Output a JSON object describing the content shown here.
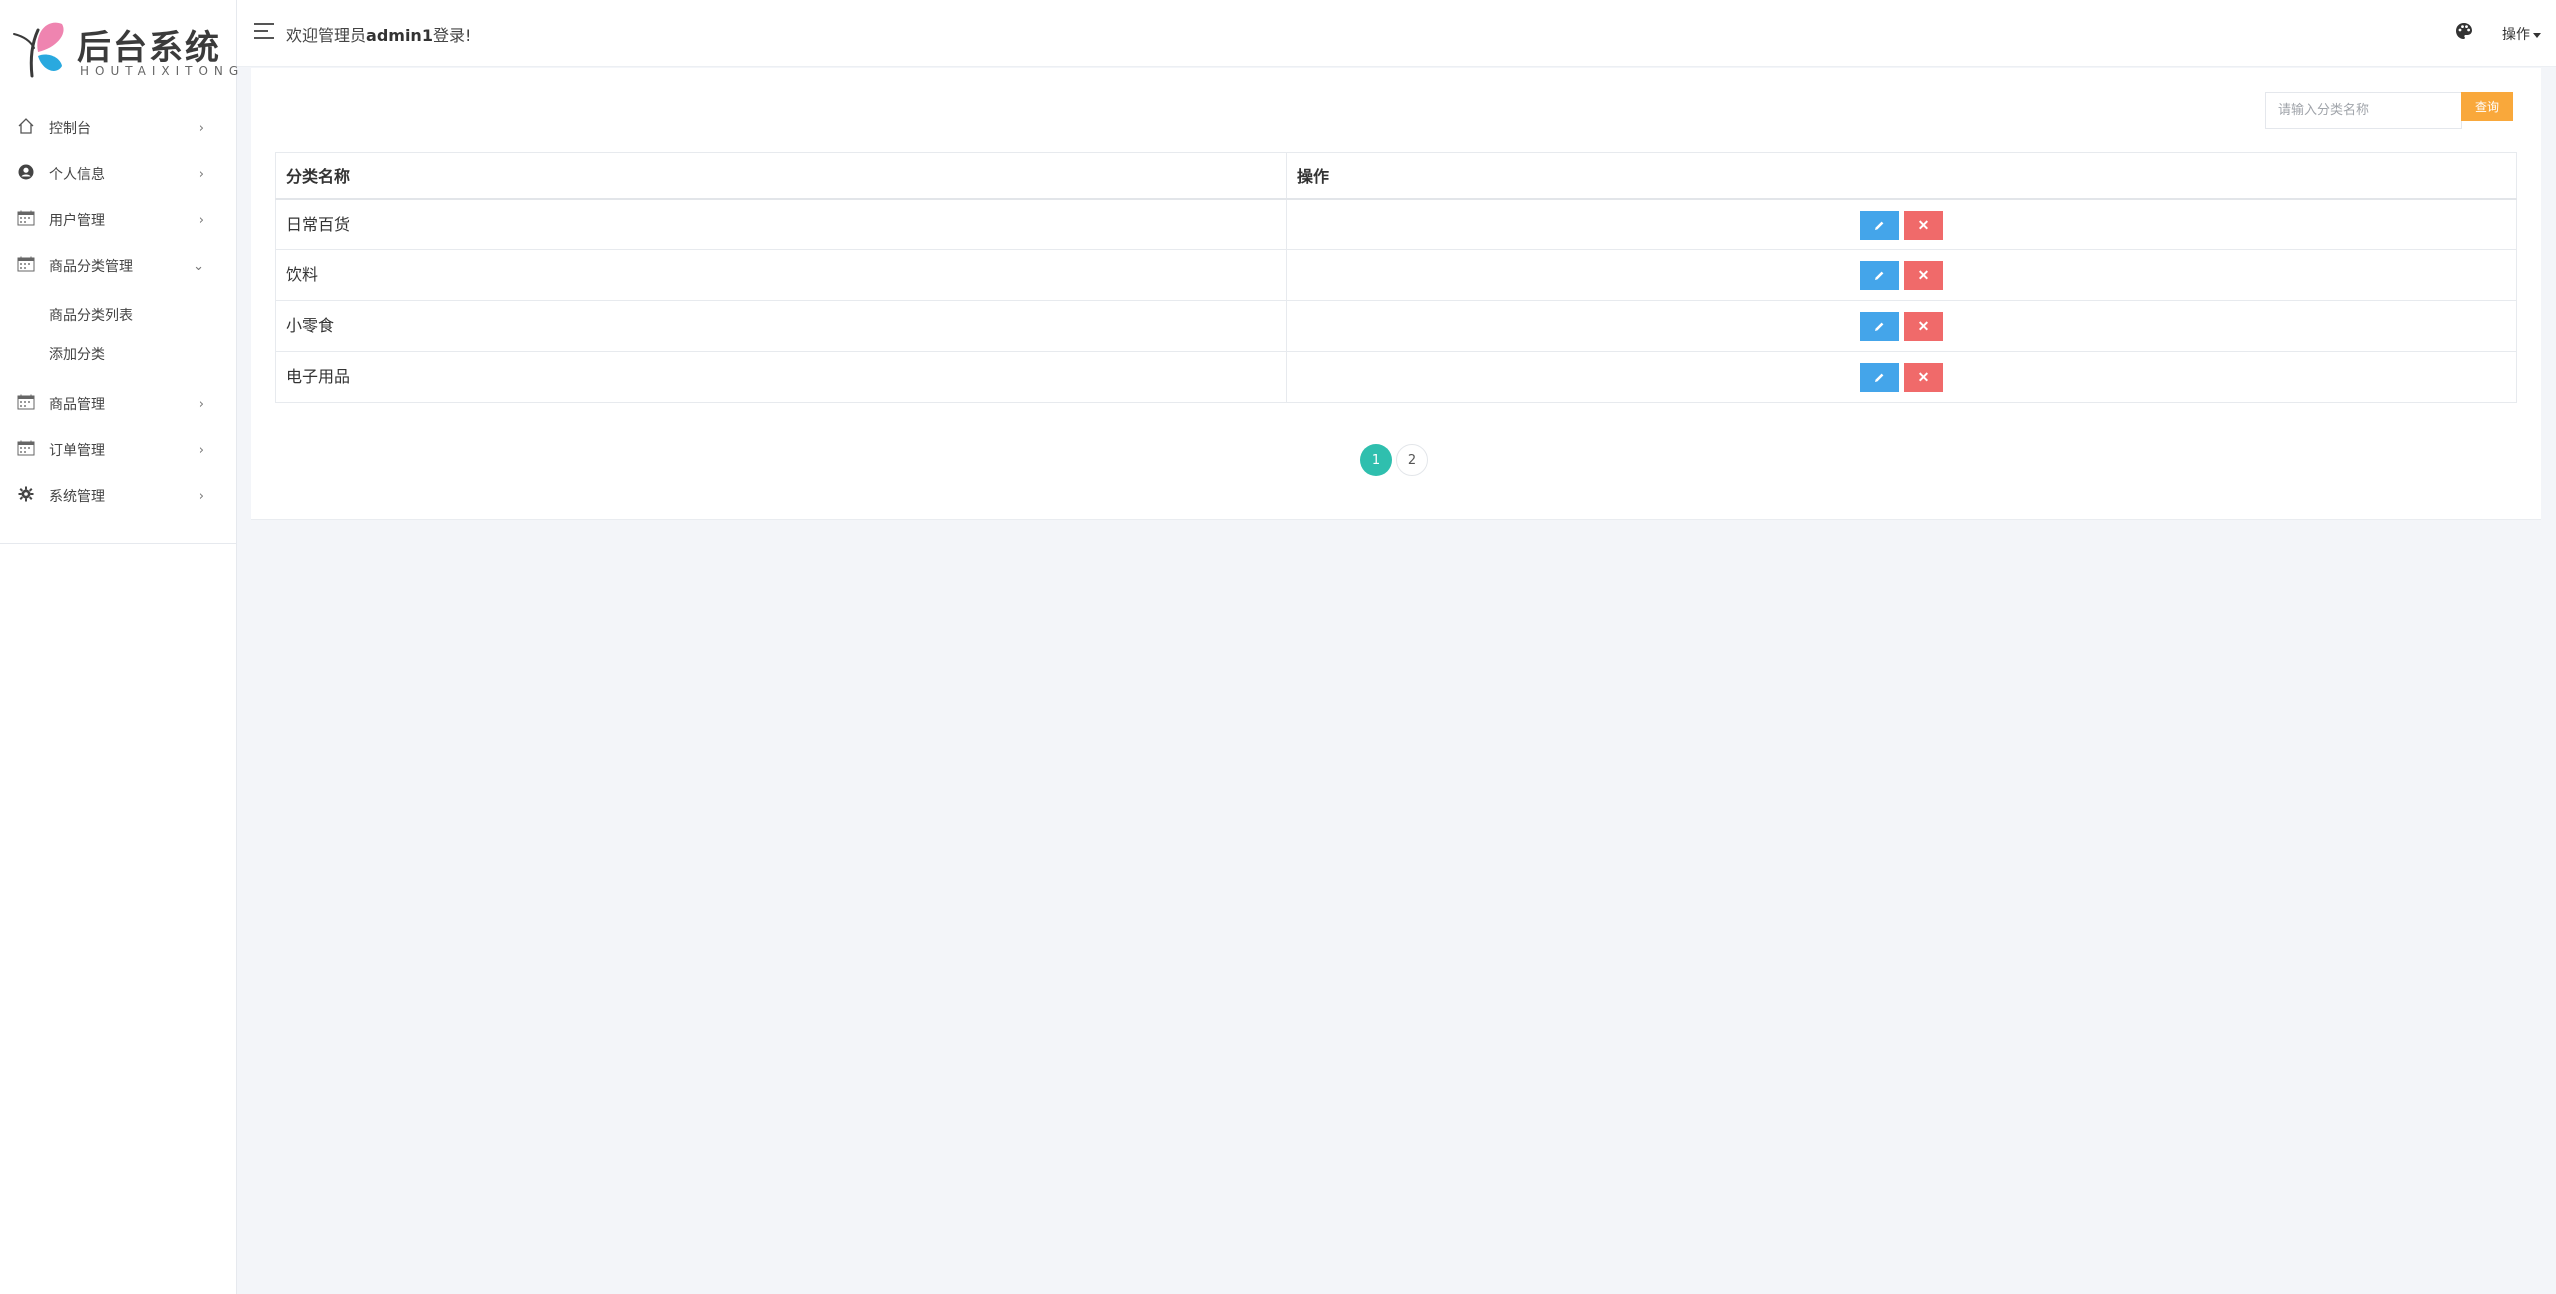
{
  "brand": {
    "title": "后台系统",
    "subtitle": "HOUTAIXITONG"
  },
  "sidebar": {
    "items": [
      {
        "label": "控制台",
        "icon": "home-icon",
        "chevron": "›"
      },
      {
        "label": "个人信息",
        "icon": "user-circle-icon",
        "chevron": "›"
      },
      {
        "label": "用户管理",
        "icon": "calendar-icon",
        "chevron": "›"
      },
      {
        "label": "商品分类管理",
        "icon": "calendar-icon",
        "chevron": "⌄",
        "expanded": true
      },
      {
        "label": "商品管理",
        "icon": "calendar-icon",
        "chevron": "›"
      },
      {
        "label": "订单管理",
        "icon": "calendar-icon",
        "chevron": "›"
      },
      {
        "label": "系统管理",
        "icon": "gear-icon",
        "chevron": "›"
      }
    ],
    "submenu": [
      {
        "label": "商品分类列表"
      },
      {
        "label": "添加分类"
      }
    ]
  },
  "header": {
    "welcome_prefix": "欢迎管理员",
    "username": "admin1",
    "welcome_suffix": "登录!",
    "ops_label": "操作"
  },
  "search": {
    "placeholder": "请输入分类名称",
    "button_label": "查询"
  },
  "table": {
    "columns": [
      "分类名称",
      "操作"
    ],
    "rows": [
      {
        "name": "日常百货"
      },
      {
        "name": "饮料"
      },
      {
        "name": "小零食"
      },
      {
        "name": "电子用品"
      }
    ],
    "delete_glyph": "✕"
  },
  "pagination": {
    "pages": [
      "1",
      "2"
    ],
    "current": "1"
  },
  "colors": {
    "accent": "#2fbfae",
    "edit": "#44a5ea",
    "delete": "#f06a6a",
    "search": "#f9a83b"
  }
}
